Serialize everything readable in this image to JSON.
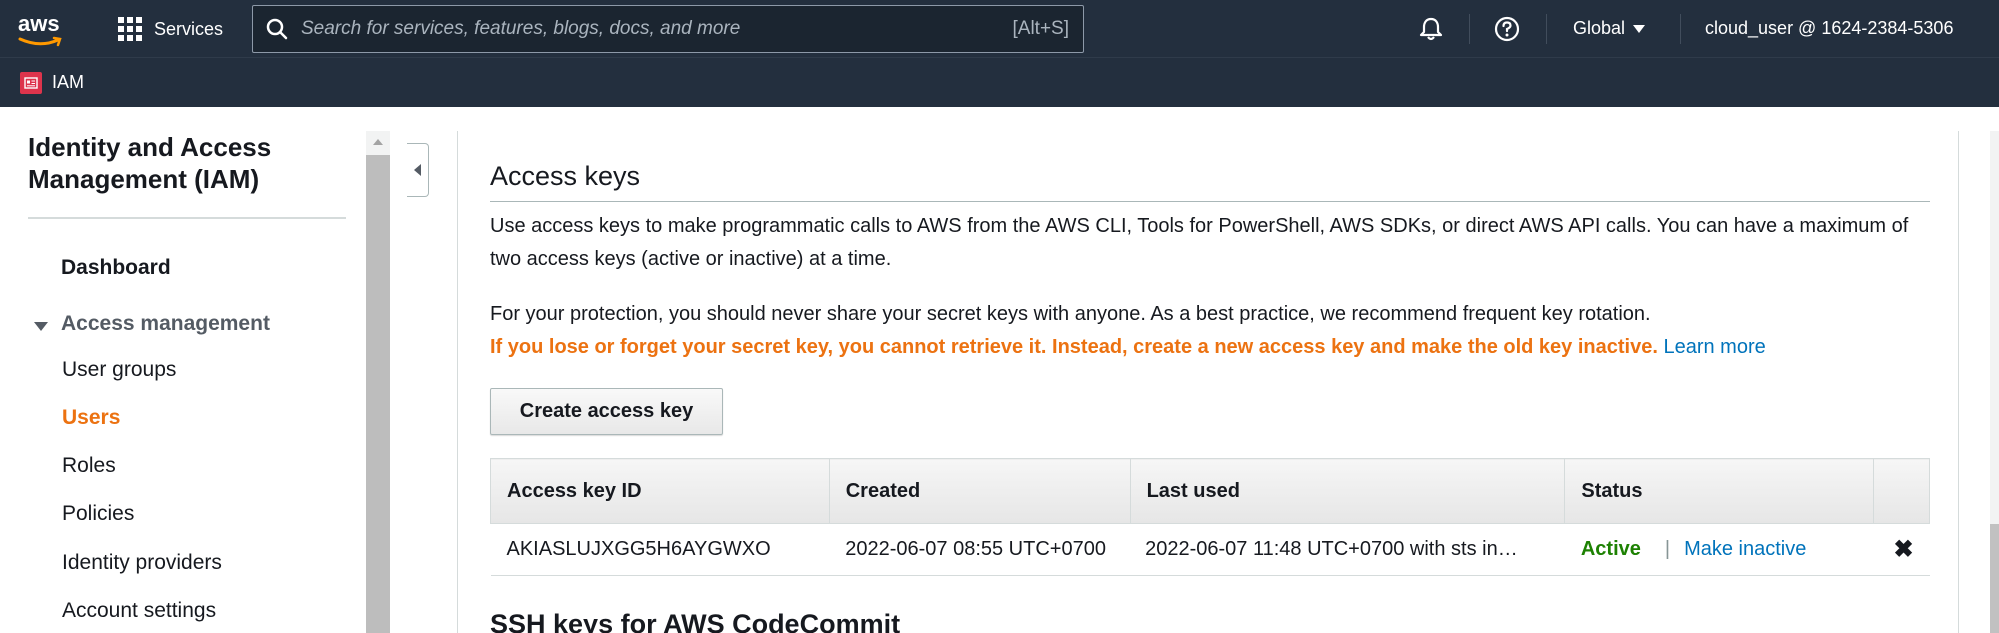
{
  "topnav": {
    "logo_text": "aws",
    "services_label": "Services",
    "search_placeholder": "Search for services, features, blogs, docs, and more",
    "search_shortcut": "[Alt+S]",
    "region_label": "Global",
    "account_label": "cloud_user @ 1624-2384-5306"
  },
  "subbar": {
    "service_label": "IAM"
  },
  "sidebar": {
    "title": "Identity and Access Management (IAM)",
    "dashboard": "Dashboard",
    "section": "Access management",
    "items": [
      {
        "label": "User groups"
      },
      {
        "label": "Users"
      },
      {
        "label": "Roles"
      },
      {
        "label": "Policies"
      },
      {
        "label": "Identity providers"
      },
      {
        "label": "Account settings"
      }
    ]
  },
  "access_keys": {
    "heading": "Access keys",
    "description": "Use access keys to make programmatic calls to AWS from the AWS CLI, Tools for PowerShell, AWS SDKs, or direct AWS API calls. You can have a maximum of two access keys (active or inactive) at a time.",
    "protection": "For your protection, you should never share your secret keys with anyone. As a best practice, we recommend frequent key rotation.",
    "warning": "If you lose or forget your secret key, you cannot retrieve it. Instead, create a new access key and make the old key inactive.",
    "learn_more": "Learn more",
    "create_button": "Create access key",
    "columns": [
      "Access key ID",
      "Created",
      "Last used",
      "Status"
    ],
    "rows": [
      {
        "key_id": "AKIASLUJXGG5H6AYGWXO",
        "created": "2022-06-07 08:55 UTC+0700",
        "last_used": "2022-06-07 11:48 UTC+0700 with sts in…",
        "status": "Active",
        "separator": "|",
        "action": "Make inactive",
        "delete_glyph": "✖"
      }
    ]
  },
  "ssh_keys": {
    "heading": "SSH keys for AWS CodeCommit"
  },
  "colors": {
    "nav_bg": "#232f3e",
    "accent_orange": "#ec7211",
    "link_blue": "#0073bb",
    "active_green": "#1d8102",
    "iam_red": "#dd344c"
  }
}
